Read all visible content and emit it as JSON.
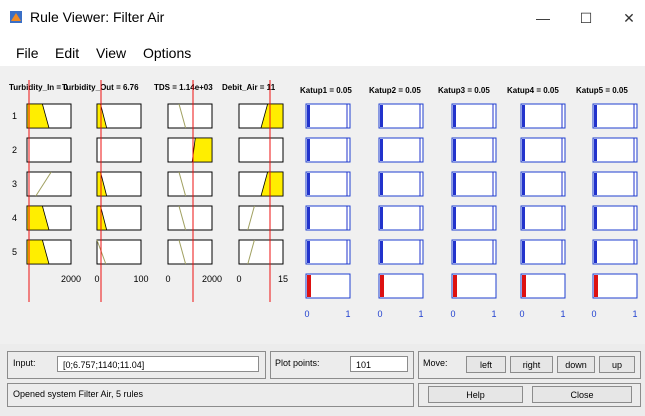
{
  "window": {
    "title": "Rule Viewer: Filter Air",
    "minimize_glyph": "—",
    "maximize_glyph": "☐",
    "close_glyph": "✕"
  },
  "menu": [
    "File",
    "Edit",
    "View",
    "Options"
  ],
  "inputs_header": {
    "turbidity_in": "Turbidity_In = 0",
    "turbidity_out": "Turbidity_Out = 6.76",
    "tds": "TDS = 1.14e+03",
    "debit_air": "Debit_Air = 11"
  },
  "outputs_header": [
    "Katup1 = 0.05",
    "Katup2 = 0.05",
    "Katup3 = 0.05",
    "Katup4 = 0.05",
    "Katup5 = 0.05"
  ],
  "rule_numbers": [
    "1",
    "2",
    "3",
    "4",
    "5"
  ],
  "input_axes": [
    {
      "min": "",
      "max": "2000"
    },
    {
      "min": "0",
      "max": "100"
    },
    {
      "min": "0",
      "max": "2000"
    },
    {
      "min": "0",
      "max": "15"
    }
  ],
  "output_axis": {
    "min": "0",
    "max": "1"
  },
  "controls": {
    "input_label": "Input:",
    "input_value": "[0;6.757;1140;11.04]",
    "plot_points_label": "Plot points:",
    "plot_points_value": "101",
    "move_label": "Move:",
    "left": "left",
    "right": "right",
    "down": "down",
    "up": "up",
    "help": "Help",
    "close": "Close"
  },
  "status": "Opened system Filter Air, 5 rules",
  "colors": {
    "input_fill": "#ffee00",
    "output_fill": "#2233cc",
    "aggregate_fill": "#dd1111",
    "index_line": "#ee1111",
    "output_axis_text": "#1f3fcf"
  }
}
